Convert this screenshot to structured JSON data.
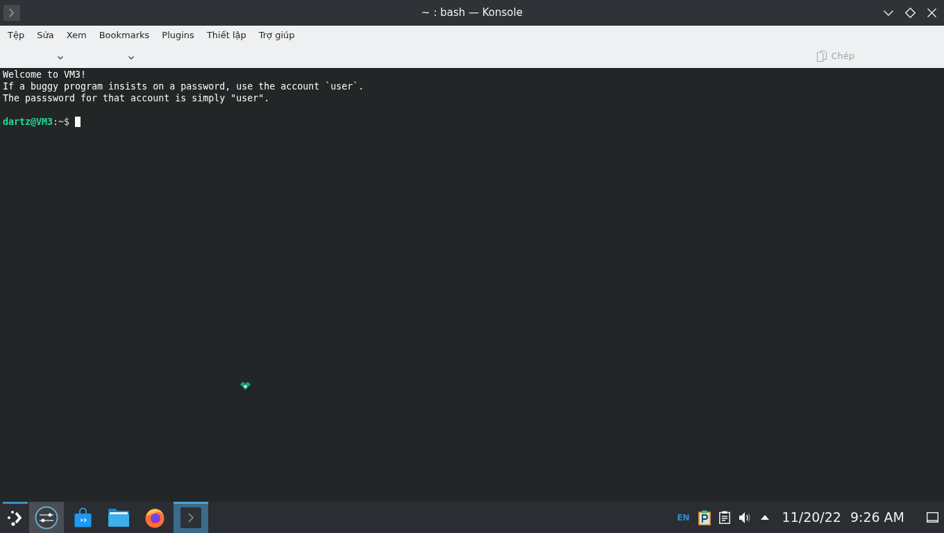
{
  "window": {
    "title": "~ : bash — Konsole"
  },
  "menu_bar": [
    "Tệp",
    "Sửa",
    "Xem",
    "Bookmarks",
    "Plugins",
    "Thiết lập",
    "Trợ giúp"
  ],
  "toolbar": [
    {
      "kind": "dropdown"
    },
    {
      "kind": "dropdown"
    },
    {
      "kind": "button",
      "label": "Chép",
      "disabled": true
    }
  ],
  "terminal": {
    "lines": [
      {
        "kind": "output",
        "text": "Welcome to VM3!"
      },
      {
        "kind": "output",
        "text": "If a buggy program insists on a password, use the account `user`."
      },
      {
        "kind": "output",
        "text": "The passsword for that account is simply \"user\"."
      },
      {
        "kind": "blank"
      },
      {
        "kind": "prompt",
        "user_host": "dartz@VM3",
        "path": ":~$"
      }
    ]
  },
  "taskbar": {
    "tasks": [
      {
        "kind": "launcher",
        "active": true,
        "hovered": false
      },
      {
        "kind": "settings",
        "active": false,
        "hovered": true
      },
      {
        "kind": "store",
        "active": false,
        "hovered": false
      },
      {
        "kind": "files",
        "active": false,
        "hovered": false
      },
      {
        "kind": "browser",
        "active": false,
        "hovered": false
      },
      {
        "kind": "terminal",
        "active": true,
        "hovered": false
      }
    ]
  },
  "tray": [
    {
      "kind": "language",
      "label": "EN"
    },
    {
      "kind": "notes"
    },
    {
      "kind": "clipboard"
    },
    {
      "kind": "volume"
    },
    {
      "kind": "expand"
    }
  ],
  "clock": {
    "date": "11/20/22",
    "time": "9:26 AM"
  }
}
